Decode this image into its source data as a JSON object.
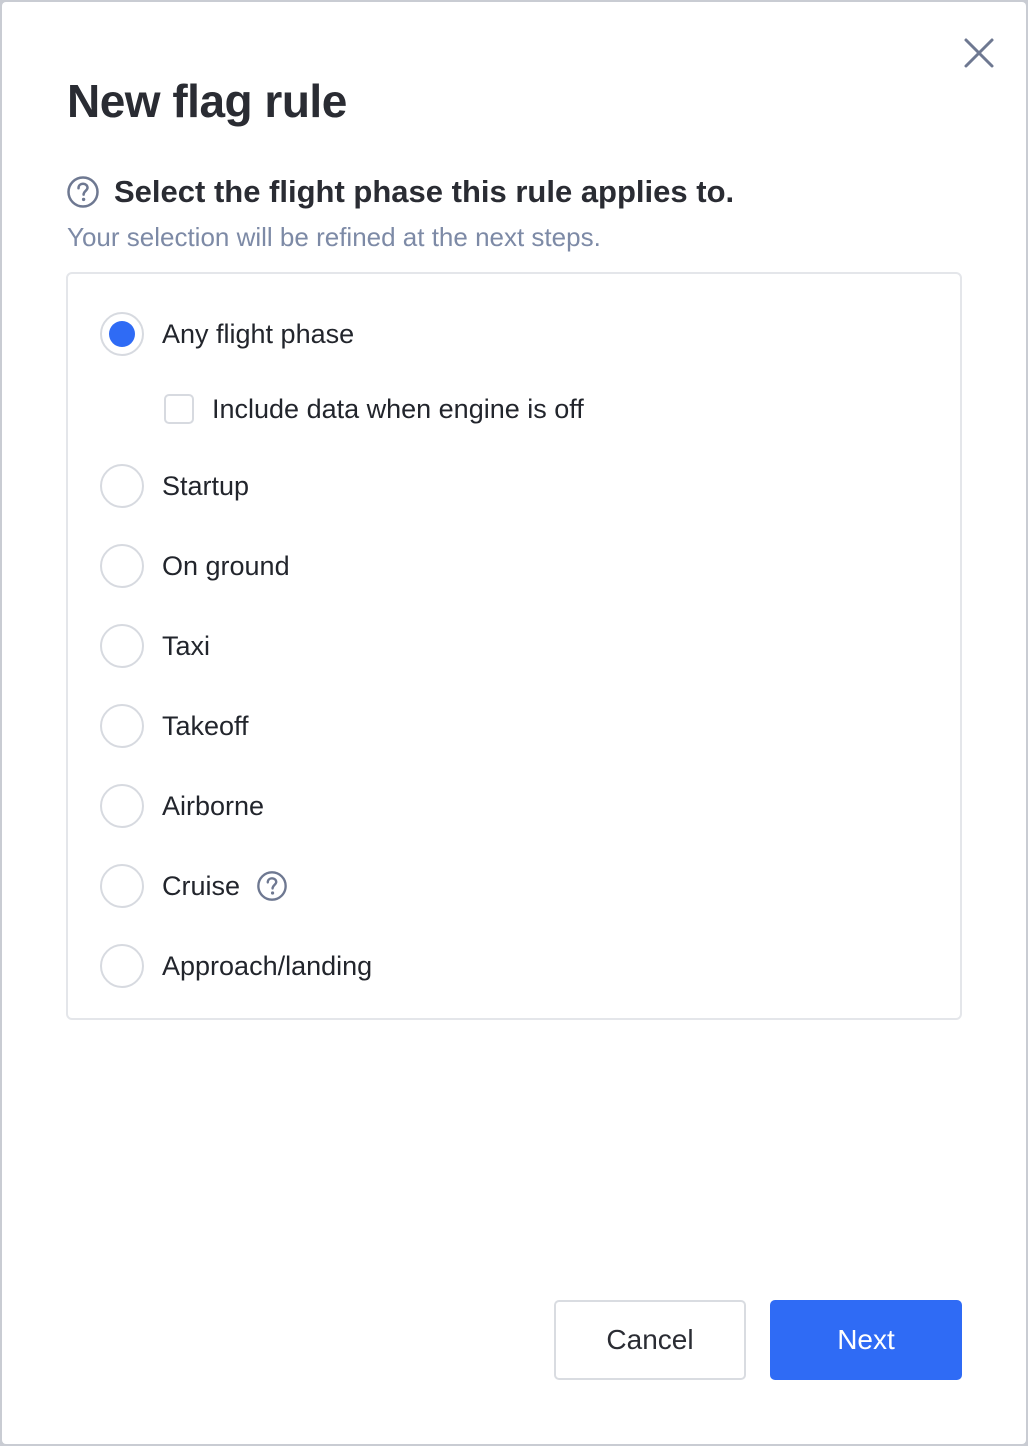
{
  "dialog": {
    "title": "New flag rule",
    "question": "Select the flight phase this rule applies to.",
    "subtext": "Your selection will be refined at the next steps."
  },
  "options": {
    "any": {
      "label": "Any flight phase",
      "selected": true
    },
    "engine_off": {
      "label": "Include data when engine is off",
      "checked": false
    },
    "startup": {
      "label": "Startup",
      "selected": false
    },
    "on_ground": {
      "label": "On ground",
      "selected": false
    },
    "taxi": {
      "label": "Taxi",
      "selected": false
    },
    "takeoff": {
      "label": "Takeoff",
      "selected": false
    },
    "airborne": {
      "label": "Airborne",
      "selected": false
    },
    "cruise": {
      "label": "Cruise",
      "selected": false
    },
    "approach_landing": {
      "label": "Approach/landing",
      "selected": false
    }
  },
  "buttons": {
    "cancel": "Cancel",
    "next": "Next"
  },
  "colors": {
    "accent": "#2f6bf5",
    "subtext": "#7d8aa6",
    "icon": "#6e7891"
  },
  "icons": {
    "close": "close-icon",
    "help": "help-circle-icon"
  }
}
